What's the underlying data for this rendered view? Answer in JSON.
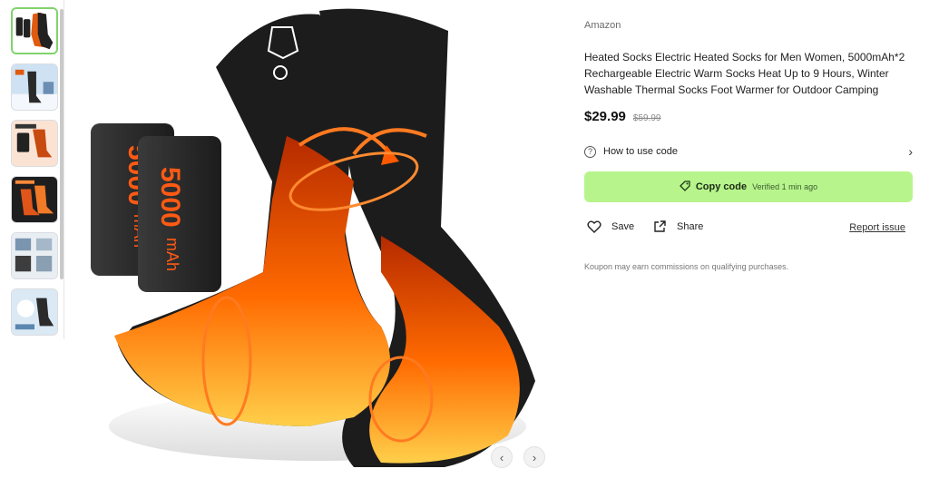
{
  "thumbnails": [
    {
      "name": "thumbnail-1",
      "active": true
    },
    {
      "name": "thumbnail-2",
      "active": false
    },
    {
      "name": "thumbnail-3",
      "active": false
    },
    {
      "name": "thumbnail-4",
      "active": false
    },
    {
      "name": "thumbnail-5",
      "active": false
    },
    {
      "name": "thumbnail-6",
      "active": false
    }
  ],
  "product_image": {
    "battery_text_1": "5000",
    "battery_unit_1": "mAh",
    "battery_text_2": "5000",
    "battery_unit_2": "mAh"
  },
  "nav": {
    "prev_icon": "‹",
    "next_icon": "›"
  },
  "detail": {
    "brand": "Amazon",
    "title": "Heated Socks Electric Heated Socks for Men Women, 5000mAh*2 Rechargeable Electric Warm Socks Heat Up to 9 Hours, Winter Washable Thermal Socks Foot Warmer for Outdoor Camping",
    "price": "$29.99",
    "old_price": "$59.99",
    "howto_label": "How to use code",
    "copy_label": "Copy code",
    "verified": "Verified 1 min ago",
    "save_label": "Save",
    "share_label": "Share",
    "report_label": "Report issue",
    "disclaimer": "Koupon may earn commissions on qualifying purchases."
  },
  "colors": {
    "accent_green": "#b7f58c",
    "flame": "#ff6a00",
    "sock": "#1c1c1c"
  }
}
